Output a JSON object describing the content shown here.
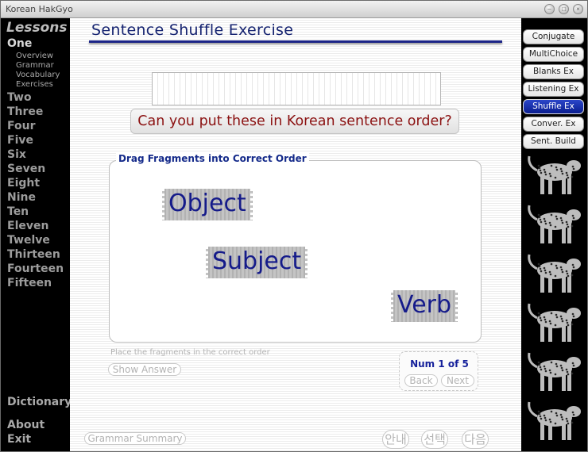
{
  "window": {
    "title": "Korean HakGyo"
  },
  "sidebar": {
    "heading": "Lessons",
    "current_lesson": "One",
    "sub_items": [
      "Overview",
      "Grammar",
      "Vocabulary",
      "Exercises"
    ],
    "lessons": [
      "Two",
      "Three",
      "Four",
      "Five",
      "Six",
      "Seven",
      "Eight",
      "Nine",
      "Ten",
      "Eleven",
      "Twelve",
      "Thirteen",
      "Fourteen",
      "Fifteen"
    ],
    "dictionary": "Dictionary",
    "about": "About",
    "exit": "Exit"
  },
  "main": {
    "title": "Sentence Shuffle Exercise",
    "answer_value": "",
    "question": "Can you put these in Korean sentence order?",
    "drag_legend": "Drag Fragments into Correct Order",
    "fragments": [
      "Object",
      "Subject",
      "Verb"
    ],
    "hint": "Place the fragments in the correct order",
    "show_answer": "Show Answer",
    "counter": "Num 1 of 5",
    "back": "Back",
    "next": "Next",
    "grammar_summary": "Grammar Summary",
    "korean_buttons": [
      "안내",
      "선택",
      "다음"
    ]
  },
  "right_nav": {
    "items": [
      "Conjugate",
      "MultiChoice",
      "Blanks Ex",
      "Listening Ex",
      "Shuffle Ex",
      "Conver. Ex",
      "Sent. Build"
    ],
    "active": "Shuffle Ex"
  },
  "colors": {
    "accent": "#1b2487",
    "question_text": "#8b1111",
    "active_nav": "#0a1d8f",
    "sidebar_bg": "#000000"
  }
}
